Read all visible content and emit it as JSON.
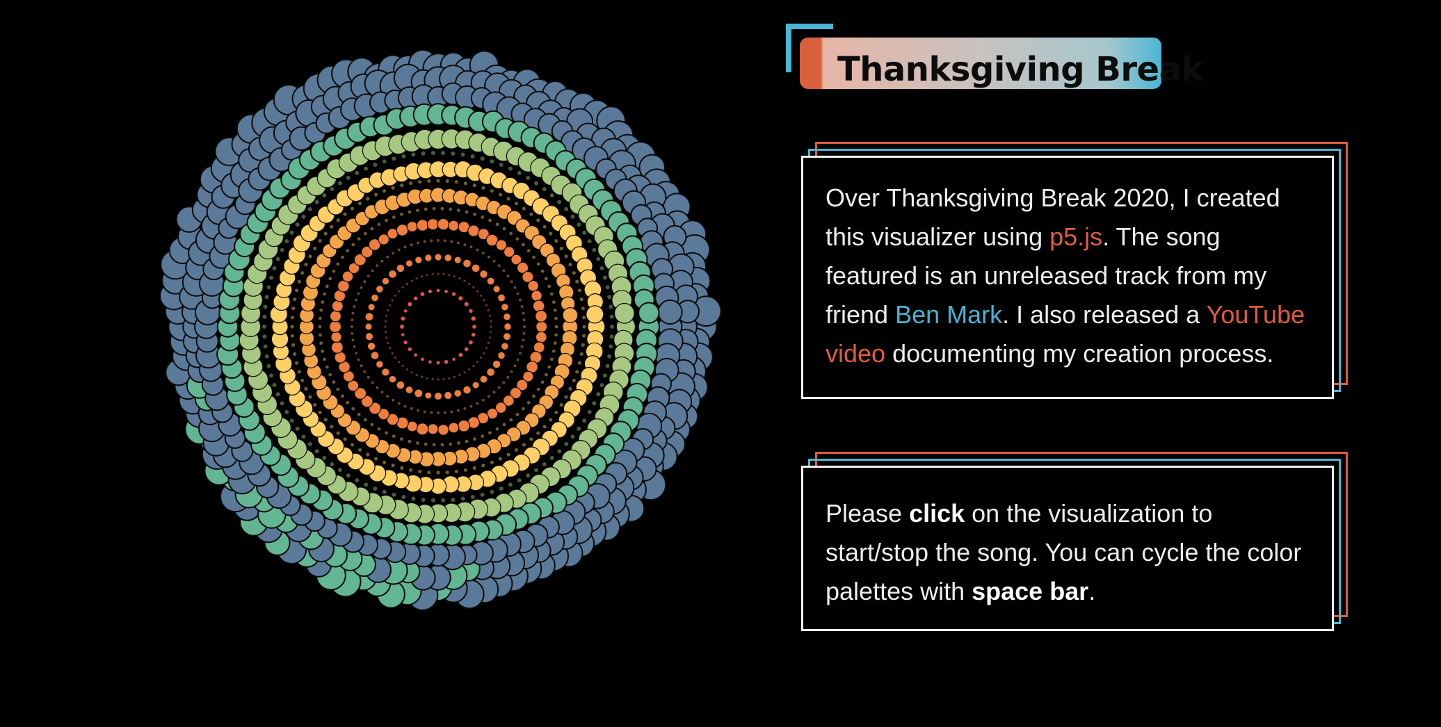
{
  "title": "Thanksgiving Break",
  "intro": {
    "part1": "Over Thanksgiving Break 2020, I created this visualizer using ",
    "link_p5": "p5.js",
    "part2": ". The song featured is an unreleased track from my friend ",
    "link_ben": "Ben Mark",
    "part3": ". I also released a ",
    "link_youtube": "YouTube video",
    "part4": " documenting my creation process."
  },
  "instructions": {
    "part1": "Please ",
    "click": "click",
    "part2": " on the visualization to start/stop the song. You can cycle the color palettes with ",
    "space_bar": "space bar",
    "part3": "."
  },
  "colors": {
    "background": "#000000",
    "accent_red": "#e25a3d",
    "accent_blue": "#4bb5d3",
    "card_border": "#eef6f0",
    "text": "#e9efe9"
  },
  "visualizer": {
    "palette": [
      "#e5524d",
      "#ee7d3e",
      "#f5a549",
      "#fdcf67",
      "#a7c880",
      "#62b693",
      "#5b7a9a"
    ]
  }
}
